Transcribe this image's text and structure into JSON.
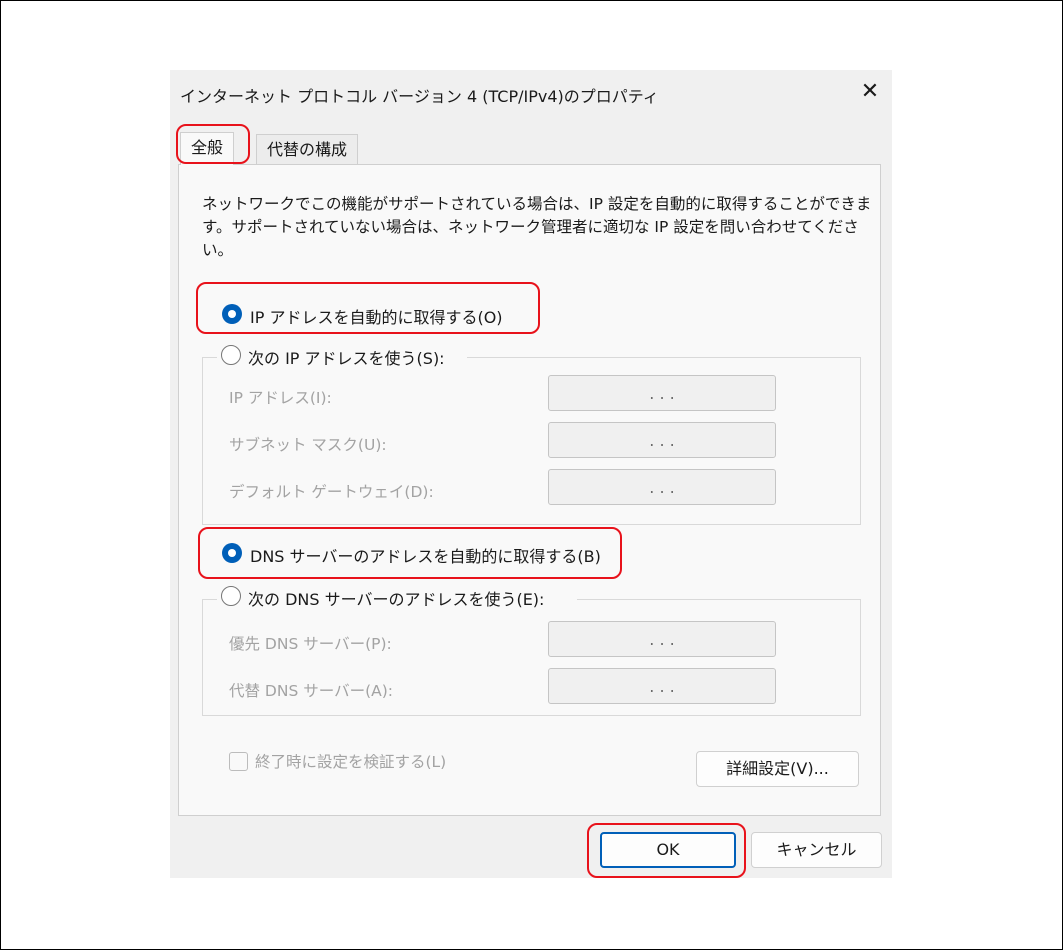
{
  "window": {
    "title": "インターネット プロトコル バージョン 4 (TCP/IPv4)のプロパティ",
    "close_glyph": "✕"
  },
  "tabs": [
    {
      "label": "全般",
      "selected": true
    },
    {
      "label": "代替の構成",
      "selected": false
    }
  ],
  "description": "ネットワークでこの機能がサポートされている場合は、IP 設定を自動的に取得することができます。サポートされていない場合は、ネットワーク管理者に適切な IP 設定を問い合わせてください。",
  "ip": {
    "auto_label": "IP アドレスを自動的に取得する(O)",
    "manual_label": "次の IP アドレスを使う(S):",
    "selected": "auto",
    "fields": [
      {
        "label": "IP アドレス(I):",
        "value": ".   .   ."
      },
      {
        "label": "サブネット マスク(U):",
        "value": ".   .   ."
      },
      {
        "label": "デフォルト ゲートウェイ(D):",
        "value": ".   .   ."
      }
    ]
  },
  "dns": {
    "auto_label": "DNS サーバーのアドレスを自動的に取得する(B)",
    "manual_label": "次の DNS サーバーのアドレスを使う(E):",
    "selected": "auto",
    "fields": [
      {
        "label": "優先 DNS サーバー(P):",
        "value": ".   .   ."
      },
      {
        "label": "代替 DNS サーバー(A):",
        "value": ".   .   ."
      }
    ]
  },
  "validate_label": "終了時に設定を検証する(L)",
  "advanced_button": "詳細設定(V)...",
  "ok_button": "OK",
  "cancel_button": "キャンセル",
  "colors": {
    "accent": "#005fb8",
    "highlight": "#e8121b",
    "disabled_text": "#a3a3a3"
  }
}
